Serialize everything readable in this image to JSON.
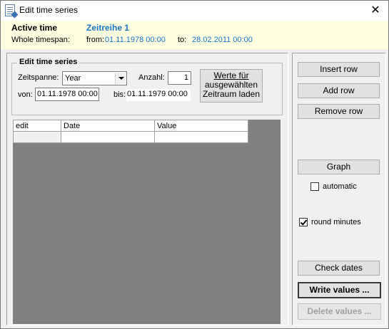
{
  "window": {
    "title": "Edit time series",
    "close_glyph": "✕"
  },
  "header": {
    "active_label": "Active time",
    "active_value": "Zeitreihe 1",
    "whole_label": "Whole timespan:",
    "from_label": "from:",
    "from_value": "01.11.1978 00:00",
    "to_label": "to:",
    "to_value": "28.02.2011 00:00"
  },
  "edit_group": {
    "title": "Edit time series",
    "zeitspanne_label": "Zeitspanne:",
    "zeitspanne_value": "Year",
    "anzahl_label": "Anzahl:",
    "anzahl_value": "1",
    "von_label": "von:",
    "von_value": "01.11.1978 00:00",
    "bis_label": "bis:",
    "bis_value": "01.11.1979 00:00",
    "load_button_lines": [
      "Werte für",
      "ausgewählten",
      "Zeitraum laden"
    ]
  },
  "grid": {
    "columns": [
      "edit",
      "Date",
      "Value"
    ],
    "rows": [
      [
        "",
        "",
        ""
      ]
    ]
  },
  "side": {
    "insert_row": "Insert row",
    "add_row": "Add row",
    "remove_row": "Remove row",
    "graph": "Graph",
    "automatic_label": "automatic",
    "automatic_checked": false,
    "round_minutes_label": "round minutes",
    "round_minutes_checked": true,
    "check_dates": "Check dates",
    "write_values": "Write values ...",
    "delete_values": "Delete values ..."
  }
}
